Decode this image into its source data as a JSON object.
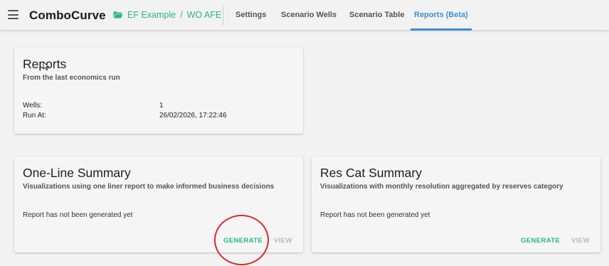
{
  "app": {
    "brand": "ComboCurve"
  },
  "breadcrumb": {
    "project": "EF Example",
    "separator": "/",
    "scenario": "WO AFE"
  },
  "tabs": [
    {
      "label": "Settings"
    },
    {
      "label": "Scenario Wells"
    },
    {
      "label": "Scenario Table"
    },
    {
      "label": "Reports (Beta)",
      "active": true
    }
  ],
  "reports_card": {
    "title": "Reports",
    "subtitle": "From the last economics run",
    "wells_label": "Wells:",
    "wells_value": "1",
    "run_at_label": "Run At:",
    "run_at_value": "26/02/2026, 17:22:46"
  },
  "one_line_card": {
    "title": "One-Line Summary",
    "subtitle": "Visualizations using one liner report to make informed business decisions",
    "status": "Report has not been generated yet",
    "generate_label": "GENERATE",
    "view_label": "VIEW"
  },
  "res_cat_card": {
    "title": "Res Cat Summary",
    "subtitle": "Visualizations with monthly resolution aggregated by reserves category",
    "status": "Report has not been generated yet",
    "generate_label": "GENERATE",
    "view_label": "VIEW"
  },
  "colors": {
    "accent_green": "#2bb58a",
    "tab_active_blue": "#3d8fd1",
    "annotation_red": "#d62b2b",
    "disabled_gray": "#b8b8b8"
  },
  "icons": {
    "menu": "hamburger-menu-icon",
    "folder": "folder-open-icon",
    "cursor": "mouse-cursor-icon"
  }
}
